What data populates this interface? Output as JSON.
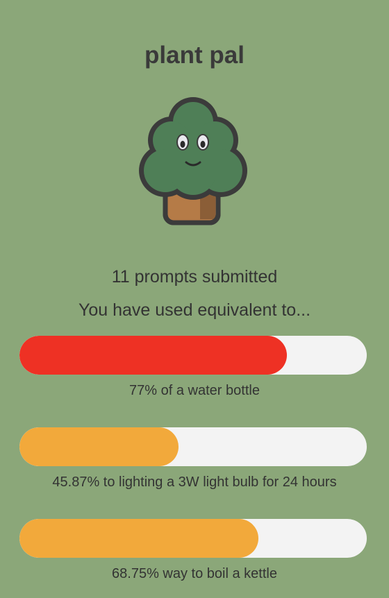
{
  "app": {
    "title": "plant pal"
  },
  "mascot": {
    "icon": "tree-mascot-icon",
    "colors": {
      "foliage": "#4f7f57",
      "outline": "#3b3b3b",
      "pot": "#b57b47",
      "pot_shadow": "#8b5e37"
    }
  },
  "stats": {
    "prompts_text": "11 prompts submitted",
    "prompt_count": 11,
    "intro_text": "You have used equivalent to..."
  },
  "meters": [
    {
      "caption": "77% of a water bottle",
      "percent": 77,
      "color": "#ee3124"
    },
    {
      "caption": "45.87% to lighting a 3W light bulb for 24 hours",
      "percent": 45.87,
      "color": "#f2a93b"
    },
    {
      "caption": "68.75% way to boil a kettle",
      "percent": 68.75,
      "color": "#f2a93b"
    }
  ],
  "colors": {
    "background": "#8ba779",
    "track": "#f3f3f3",
    "text": "#333333"
  }
}
